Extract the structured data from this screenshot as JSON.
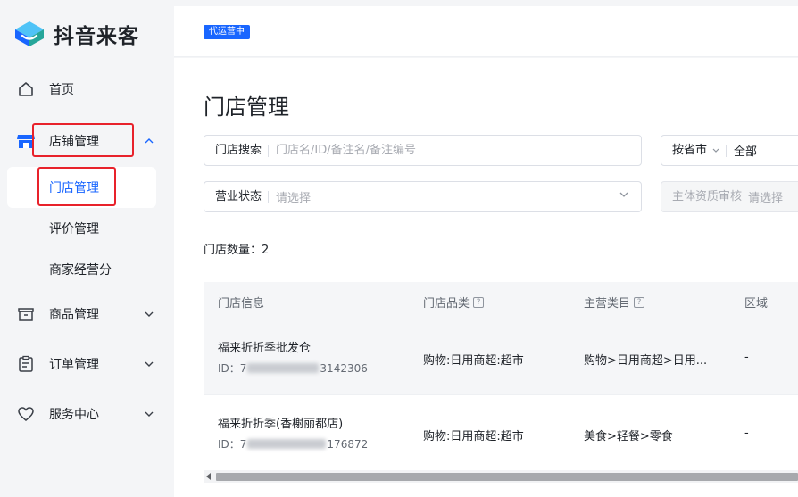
{
  "brand": {
    "name": "抖音来客"
  },
  "sidebar": {
    "items": [
      {
        "label": "首页",
        "icon": "home-icon"
      },
      {
        "label": "店铺管理",
        "icon": "shop-icon",
        "expanded": true,
        "children": [
          {
            "label": "门店管理",
            "active": true
          },
          {
            "label": "评价管理"
          },
          {
            "label": "商家经营分"
          }
        ]
      },
      {
        "label": "商品管理",
        "icon": "product-box-icon"
      },
      {
        "label": "订单管理",
        "icon": "order-clipboard-icon"
      },
      {
        "label": "服务中心",
        "icon": "heart-service-icon"
      }
    ]
  },
  "header": {
    "badge": "代运营中"
  },
  "page": {
    "title": "门店管理"
  },
  "filters": {
    "search": {
      "label": "门店搜索",
      "placeholder": "门店名/ID/备注名/备注编号"
    },
    "region": {
      "label": "按省市",
      "value": "全部"
    },
    "status": {
      "label": "营业状态",
      "placeholder": "请选择"
    },
    "qualification": {
      "label": "主体资质审核",
      "placeholder": "请选择"
    }
  },
  "summary": {
    "count_label": "门店数量：2"
  },
  "table": {
    "columns": [
      "门店信息",
      "门店品类",
      "主营类目",
      "区域"
    ],
    "rows": [
      {
        "name": "福来折折季批发仓",
        "id_prefix": "ID：7",
        "id_suffix": "3142306",
        "category": "购物:日用商超:超市",
        "main_category": "购物>日用商超>日用...",
        "region": "-"
      },
      {
        "name": "福来折折季(香榭丽都店)",
        "id_prefix": "ID：7",
        "id_suffix": "176872",
        "category": "购物:日用商超:超市",
        "main_category": "美食>轻餐>零食",
        "region": "-"
      }
    ]
  },
  "colors": {
    "accent": "#1966ff",
    "highlight": "#e8222b"
  }
}
